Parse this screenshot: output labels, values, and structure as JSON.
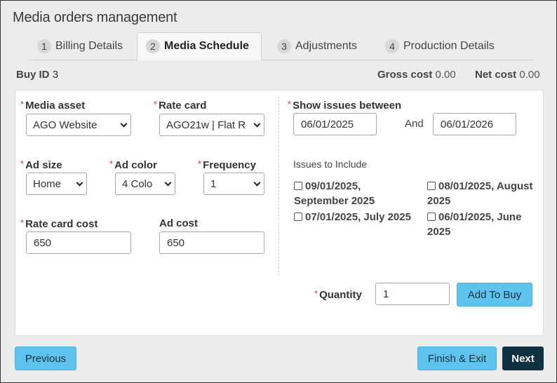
{
  "page": {
    "title": "Media orders management"
  },
  "tabs": [
    {
      "num": "1",
      "label": "Billing Details"
    },
    {
      "num": "2",
      "label": "Media Schedule"
    },
    {
      "num": "3",
      "label": "Adjustments"
    },
    {
      "num": "4",
      "label": "Production Details"
    }
  ],
  "summary": {
    "buy_id_label": "Buy ID",
    "buy_id_value": "3",
    "gross_label": "Gross cost",
    "gross_value": "0.00",
    "net_label": "Net cost",
    "net_value": "0.00"
  },
  "form": {
    "required_mark": "*",
    "media_asset": {
      "label": "Media asset",
      "value": "AGO Website"
    },
    "rate_card": {
      "label": "Rate card",
      "value": "AGO21w | Flat R"
    },
    "ad_size": {
      "label": "Ad size",
      "value": "Home"
    },
    "ad_color": {
      "label": "Ad color",
      "value": "4 Colo"
    },
    "frequency": {
      "label": "Frequency",
      "value": "1"
    },
    "rate_card_cost": {
      "label": "Rate card cost",
      "value": "650"
    },
    "ad_cost": {
      "label": "Ad cost",
      "value": "650"
    },
    "show_issues": {
      "label": "Show issues between",
      "from": "06/01/2025",
      "and_label": "And",
      "to": "06/01/2026"
    },
    "issues_label": "Issues to Include",
    "issues": [
      "09/01/2025, September 2025",
      "08/01/2025, August 2025",
      "07/01/2025, July 2025",
      "06/01/2025, June 2025"
    ],
    "quantity": {
      "label": "Quantity",
      "value": "1"
    },
    "add_to_buy_label": "Add To Buy"
  },
  "footer": {
    "previous_label": "Previous",
    "finish_label": "Finish & Exit",
    "next_label": "Next"
  },
  "colors": {
    "accent_button": "#5ec4ee",
    "dark_button": "#0f3140",
    "required": "#d23c3c"
  }
}
